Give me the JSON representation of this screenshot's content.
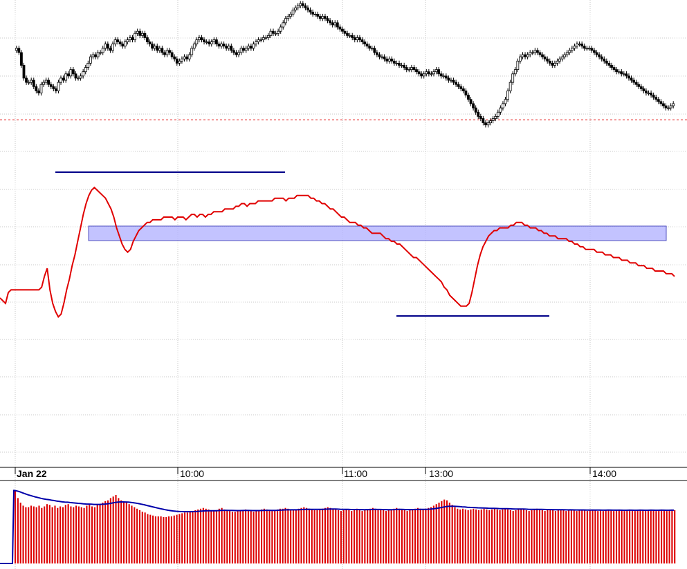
{
  "chart_data": [
    {
      "type": "candlestick",
      "panel": "price",
      "price_range": [
        0,
        100
      ],
      "reference_level": 58.4,
      "candles_close": [
        92,
        90,
        84,
        78,
        76,
        76,
        77,
        74,
        72,
        71,
        75,
        76,
        77,
        75,
        74,
        73,
        72,
        76,
        78,
        77,
        80,
        79,
        82,
        80,
        78,
        78,
        79,
        81,
        83,
        85,
        88,
        89,
        88,
        90,
        90,
        92,
        94,
        92,
        91,
        94,
        96,
        95,
        94,
        93,
        95,
        96,
        97,
        96,
        99,
        100,
        98,
        99,
        97,
        95,
        94,
        92,
        93,
        91,
        92,
        90,
        89,
        91,
        90,
        88,
        87,
        85,
        86,
        87,
        88,
        87,
        89,
        92,
        94,
        96,
        97,
        96,
        95,
        95,
        94,
        95,
        96,
        94,
        93,
        94,
        93,
        92,
        93,
        91,
        90,
        89,
        90,
        92,
        91,
        92,
        93,
        92,
        94,
        95,
        96,
        96,
        97,
        97,
        98,
        100,
        99,
        99,
        100,
        102,
        104,
        106,
        107,
        108,
        110,
        111,
        112,
        113,
        112,
        111,
        110,
        109,
        108,
        108,
        107,
        106,
        107,
        106,
        105,
        104,
        103,
        104,
        102,
        101,
        100,
        99,
        98,
        98,
        97,
        96,
        97,
        96,
        95,
        94,
        93,
        92,
        92,
        90,
        89,
        88,
        88,
        87,
        86,
        87,
        86,
        85,
        85,
        84,
        84,
        83,
        82,
        82,
        83,
        82,
        81,
        80,
        79,
        80,
        81,
        80,
        80,
        81,
        82,
        80,
        79,
        79,
        78,
        77,
        77,
        76,
        75,
        74,
        73,
        72,
        70,
        68,
        66,
        64,
        62,
        60,
        59,
        57,
        56,
        57,
        58,
        59,
        60,
        62,
        64,
        66,
        68,
        72,
        76,
        80,
        82,
        86,
        88,
        89,
        88,
        89,
        90,
        90,
        91,
        90,
        89,
        88,
        87,
        86,
        85,
        84,
        85,
        86,
        87,
        88,
        89,
        90,
        91,
        92,
        93,
        94,
        94,
        93,
        92,
        92,
        92,
        91,
        90,
        89,
        88,
        87,
        86,
        85,
        84,
        83,
        82,
        81,
        81,
        80,
        80,
        79,
        78,
        77,
        76,
        75,
        74,
        73,
        72,
        71,
        71,
        70,
        69,
        68,
        67,
        66,
        65,
        64,
        64,
        65,
        66
      ]
    },
    {
      "type": "line",
      "panel": "indicator",
      "y_range": [
        0,
        100
      ],
      "series": [
        {
          "color": "#e00000",
          "values": [
            40,
            39,
            38,
            42,
            43,
            43,
            43,
            43,
            43,
            43,
            43,
            43,
            43,
            43,
            43,
            44,
            48,
            51,
            43,
            38,
            35,
            33,
            34,
            38,
            43,
            47,
            52,
            56,
            61,
            66,
            71,
            75,
            78,
            80,
            81,
            80,
            79,
            78,
            77,
            75,
            73,
            70,
            66,
            63,
            60,
            58,
            57,
            58,
            61,
            63,
            65,
            66,
            67,
            68,
            68,
            69,
            69,
            69,
            69,
            70,
            70,
            70,
            70,
            69,
            70,
            70,
            70,
            69,
            70,
            71,
            71,
            70,
            71,
            71,
            70,
            71,
            71,
            72,
            72,
            72,
            72,
            73,
            73,
            73,
            73,
            74,
            74,
            75,
            75,
            74,
            75,
            75,
            75,
            76,
            76,
            76,
            76,
            76,
            76,
            77,
            77,
            77,
            77,
            76,
            77,
            77,
            77,
            78,
            78,
            78,
            78,
            78,
            77,
            77,
            76,
            76,
            75,
            75,
            74,
            73,
            73,
            72,
            71,
            70,
            70,
            69,
            68,
            68,
            68,
            67,
            67,
            66,
            66,
            65,
            64,
            64,
            64,
            64,
            63,
            62,
            62,
            61,
            61,
            60,
            60,
            59,
            58,
            57,
            56,
            55,
            55,
            54,
            53,
            52,
            51,
            50,
            49,
            48,
            47,
            46,
            44,
            43,
            41,
            40,
            39,
            38,
            37,
            37,
            37,
            38,
            42,
            47,
            52,
            56,
            59,
            61,
            63,
            64,
            65,
            65,
            66,
            66,
            66,
            66,
            67,
            67,
            68,
            68,
            68,
            67,
            67,
            66,
            66,
            66,
            65,
            65,
            64,
            64,
            63,
            63,
            63,
            62,
            62,
            62,
            62,
            61,
            61,
            60,
            60,
            59,
            59,
            58,
            58,
            58,
            58,
            57,
            57,
            57,
            56,
            56,
            56,
            55,
            55,
            55,
            54,
            54,
            54,
            53,
            53,
            53,
            52,
            52,
            52,
            51,
            51,
            51,
            50,
            50,
            50,
            50,
            49,
            49,
            49,
            48
          ]
        }
      ]
    },
    {
      "type": "bar",
      "panel": "volume",
      "y_range": [
        0,
        100
      ],
      "bar_color": "#dd0000",
      "average_line_color": "#0000aa",
      "values": [
        96,
        86,
        80,
        76,
        74,
        74,
        76,
        75,
        74,
        76,
        73,
        75,
        78,
        77,
        74,
        76,
        73,
        75,
        74,
        77,
        78,
        75,
        74,
        76,
        75,
        74,
        73,
        76,
        77,
        75,
        74,
        78,
        77,
        80,
        82,
        83,
        86,
        88,
        90,
        86,
        83,
        81,
        80,
        78,
        76,
        74,
        72,
        70,
        68,
        67,
        65,
        64,
        63,
        62,
        62,
        62,
        61,
        61,
        62,
        62,
        63,
        64,
        65,
        66,
        67,
        67,
        68,
        69,
        70,
        71,
        72,
        73,
        72,
        71,
        70,
        69,
        70,
        72,
        73,
        71,
        70,
        69,
        68,
        68,
        69,
        70,
        70,
        71,
        70,
        69,
        68,
        69,
        70,
        71,
        72,
        71,
        70,
        69,
        70,
        71,
        72,
        72,
        73,
        72,
        71,
        70,
        71,
        72,
        73,
        74,
        73,
        72,
        71,
        70,
        70,
        71,
        72,
        73,
        74,
        73,
        72,
        71,
        70,
        69,
        70,
        71,
        70,
        69,
        70,
        72,
        71,
        69,
        70,
        71,
        72,
        73,
        72,
        70,
        71,
        70,
        69,
        70,
        71,
        72,
        73,
        72,
        71,
        70,
        69,
        70,
        71,
        72,
        73,
        72,
        71,
        72,
        73,
        74,
        76,
        78,
        80,
        82,
        84,
        83,
        80,
        77,
        74,
        72,
        71,
        72,
        71,
        70,
        71,
        72,
        71,
        70,
        71,
        72,
        71,
        70,
        71,
        72,
        71,
        70,
        71,
        72,
        71,
        70,
        69,
        70,
        71,
        72,
        71,
        70,
        69,
        70,
        71,
        72,
        71,
        70,
        69,
        70,
        71,
        70,
        69,
        70,
        71,
        70,
        69,
        70,
        71,
        70,
        69,
        70,
        71,
        70,
        69,
        70,
        71,
        70,
        69,
        70,
        69,
        70,
        71,
        70,
        69,
        70,
        71,
        70,
        69,
        70,
        71,
        70,
        69,
        70,
        71,
        70,
        69,
        70,
        71,
        70,
        69,
        70,
        71,
        70,
        69,
        70,
        71,
        70
      ]
    }
  ],
  "time_axis": {
    "labels": [
      {
        "text": "Jan 22",
        "bold": true
      },
      {
        "text": "10:00",
        "bold": false
      },
      {
        "text": "11:00",
        "bold": false
      },
      {
        "text": "13:00",
        "bold": false
      },
      {
        "text": "14:00",
        "bold": false
      }
    ]
  },
  "colors": {
    "background": "#ffffff",
    "grid": "#c8c8c8",
    "candle": "#000000",
    "reference_line": "#e00000",
    "indicator_line": "#e00000",
    "annotation_line": "#000088",
    "highlight_band_fill": "#b4b4ff",
    "highlight_band_stroke": "#5050c0",
    "volume_bar": "#dd0000",
    "volume_average": "#0000aa"
  }
}
